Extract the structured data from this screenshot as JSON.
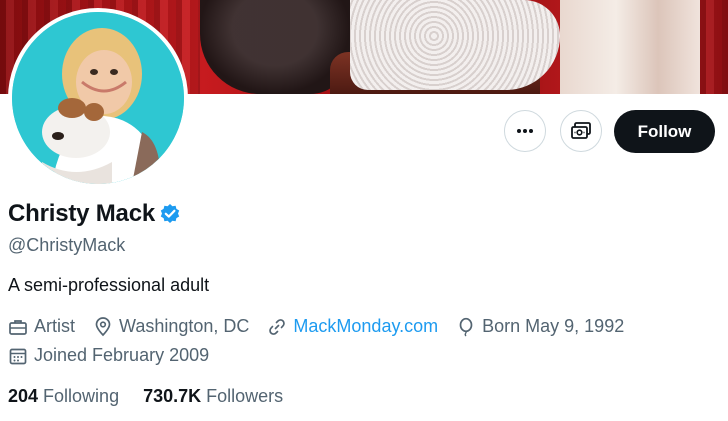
{
  "profile": {
    "display_name": "Christy Mack",
    "handle": "@ChristyMack",
    "bio": "A semi-professional adult",
    "category": "Artist",
    "location": "Washington, DC",
    "website": "MackMonday.com",
    "birthday": "Born May 9, 1992",
    "joined": "Joined February 2009",
    "following_count": "204",
    "following_label": "Following",
    "followers_count": "730.7K",
    "followers_label": "Followers",
    "verified": true
  },
  "actions": {
    "follow_label": "Follow",
    "more_icon": "ellipsis-icon",
    "subscribe_icon": "subscription-icon"
  },
  "colors": {
    "accent": "#1d9bf0",
    "text_primary": "#0f1419",
    "text_secondary": "#536471",
    "follow_bg": "#0f1419",
    "banner_red": "#b41418",
    "avatar_bg": "#2ec7d2"
  }
}
